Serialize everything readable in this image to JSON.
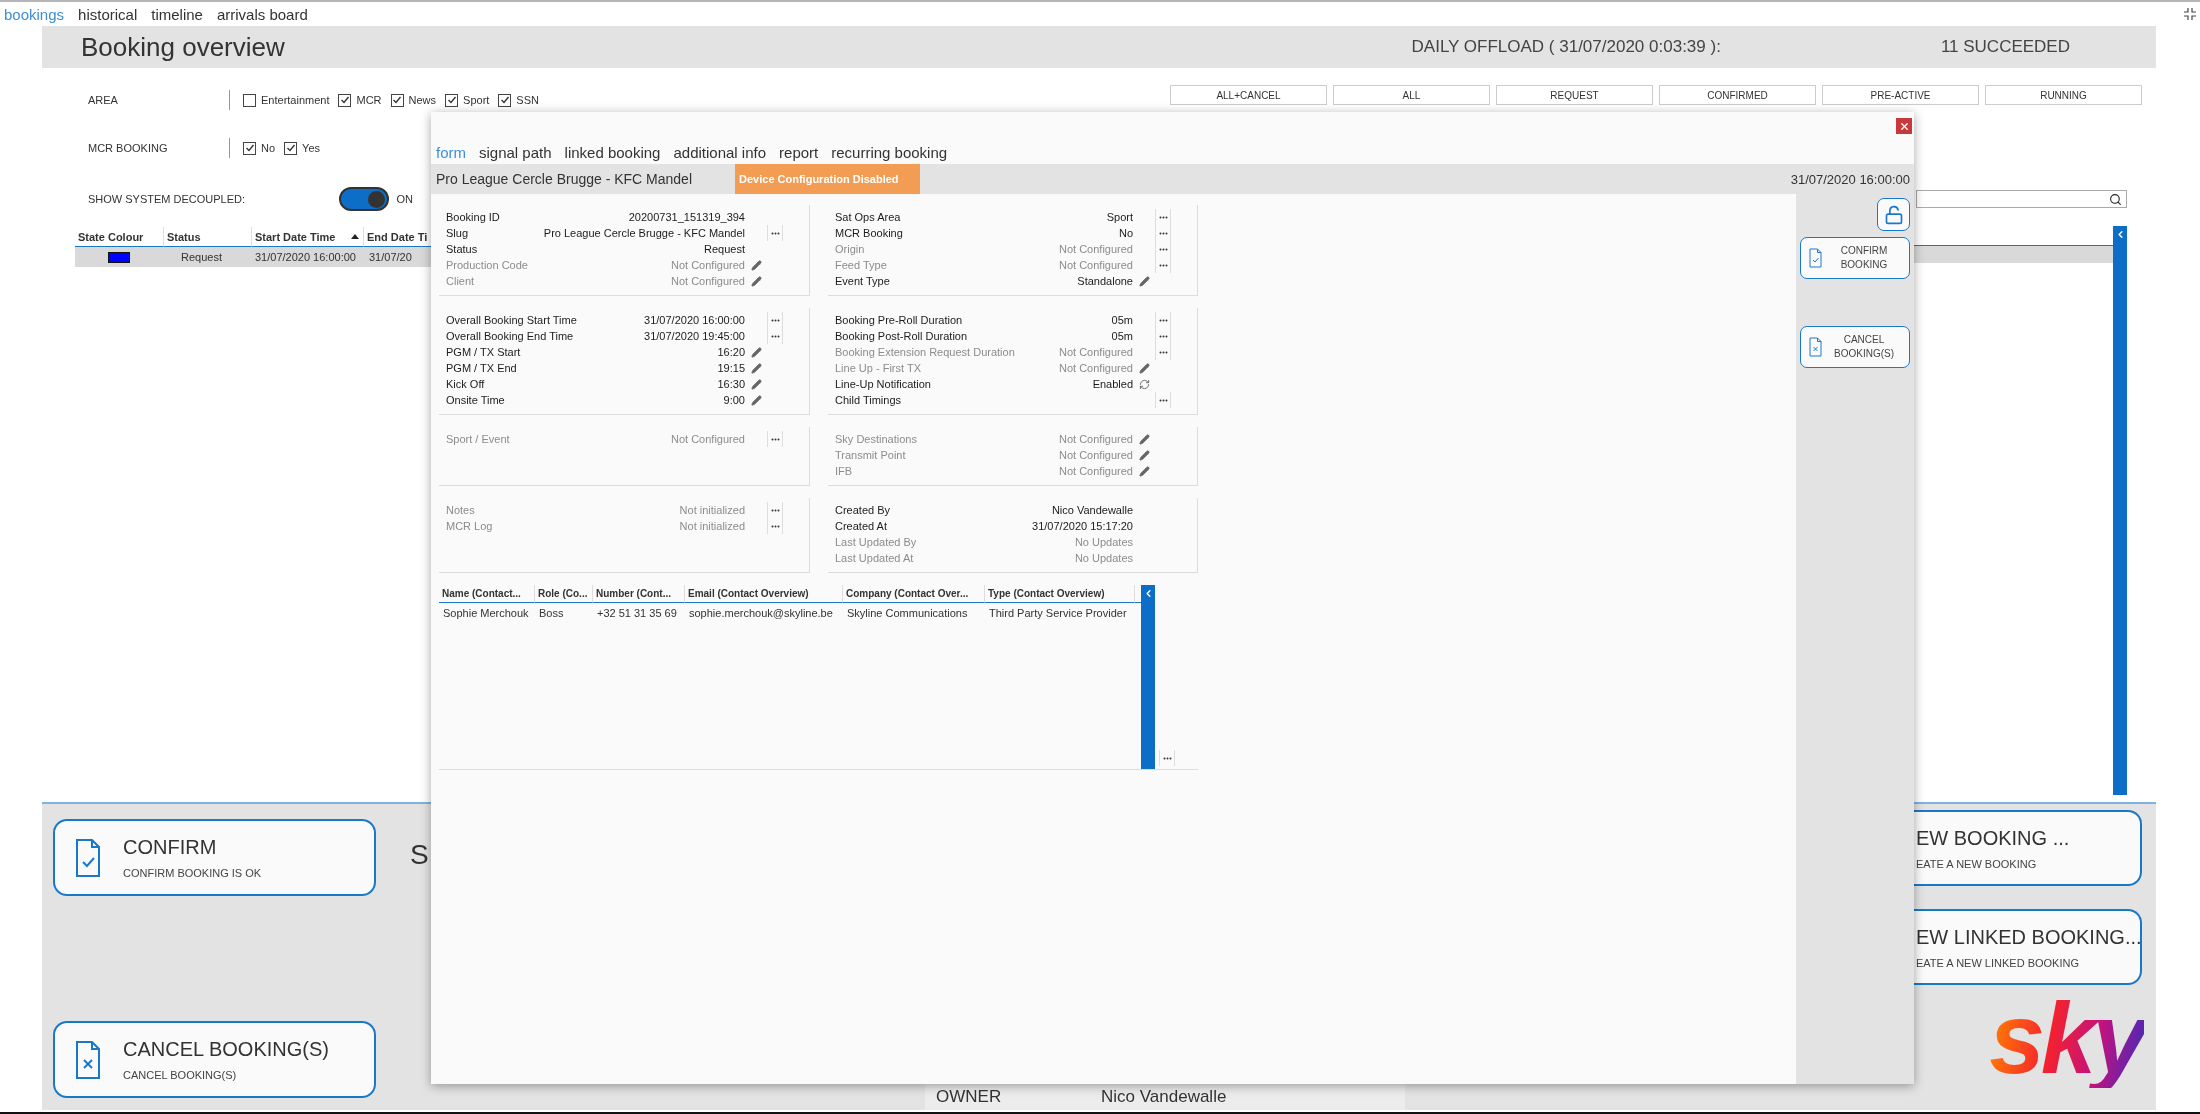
{
  "nav": [
    {
      "label": "bookings",
      "selected": true
    },
    {
      "label": "historical",
      "selected": false
    },
    {
      "label": "timeline",
      "selected": false
    },
    {
      "label": "arrivals board",
      "selected": false
    }
  ],
  "header": {
    "title": "Booking overview",
    "offload": "DAILY OFFLOAD ( 31/07/2020 0:03:39 ):",
    "result": "11 SUCCEEDED"
  },
  "status_filters": [
    "ALL+CANCEL",
    "ALL",
    "REQUEST",
    "CONFIRMED",
    "PRE-ACTIVE",
    "RUNNING"
  ],
  "filters": {
    "area": {
      "label": "AREA",
      "options": [
        {
          "label": "Entertainment",
          "checked": false
        },
        {
          "label": "MCR",
          "checked": true
        },
        {
          "label": "News",
          "checked": true
        },
        {
          "label": "Sport",
          "checked": true
        },
        {
          "label": "SSN",
          "checked": true
        }
      ]
    },
    "mcr": {
      "label": "MCR BOOKING",
      "options": [
        {
          "label": "No",
          "checked": true
        },
        {
          "label": "Yes",
          "checked": true
        }
      ]
    },
    "decoupled": {
      "label": "SHOW SYSTEM DECOUPLED:",
      "on": true,
      "state_text": "ON"
    }
  },
  "table": {
    "columns": [
      {
        "label": "State Colour"
      },
      {
        "label": "Status"
      },
      {
        "label": "Start Date Time",
        "sorted": true
      },
      {
        "label": "End Date Ti"
      }
    ],
    "rows": [
      {
        "color": "#0000ff",
        "status": "Request",
        "start": "31/07/2020 16:00:00",
        "end": "31/07/20",
        "selected": true
      }
    ]
  },
  "actions_left": [
    {
      "kind": "confirm",
      "title": "CONFIRM",
      "subtitle": "CONFIRM BOOKING IS OK"
    },
    {
      "kind": "cancel",
      "title": "CANCEL BOOKING(S)",
      "subtitle": "CANCEL BOOKING(S)"
    }
  ],
  "summary_heading": "S",
  "owner": {
    "label": "OWNER",
    "value": "Nico Vandewalle"
  },
  "actions_right": [
    {
      "title": "EW BOOKING ...",
      "subtitle": "EATE A NEW BOOKING"
    },
    {
      "title": "EW LINKED BOOKING...",
      "subtitle": "EATE A NEW LINKED BOOKING"
    }
  ],
  "logo": "sky",
  "dialog": {
    "tabs": [
      {
        "label": "form",
        "selected": true
      },
      {
        "label": "signal path",
        "selected": false
      },
      {
        "label": "linked booking",
        "selected": false
      },
      {
        "label": "additional info",
        "selected": false
      },
      {
        "label": "report",
        "selected": false
      },
      {
        "label": "recurring booking",
        "selected": false
      }
    ],
    "title": "Pro League Cercle Brugge - KFC Mandel",
    "badge": "Device Configuration Disabled",
    "date": "31/07/2020 16:00:00",
    "side_buttons": [
      {
        "kind": "unlock"
      },
      {
        "kind": "confirm",
        "label": "CONFIRM BOOKING"
      },
      {
        "kind": "cancel",
        "label": "CANCEL BOOKING(S)"
      }
    ],
    "sections": [
      {
        "rows": [
          {
            "label": "Booking ID",
            "value": "20200731_151319_394",
            "dimmed": false,
            "kind": "plain"
          },
          {
            "label": "Slug",
            "value": "Pro League Cercle Brugge - KFC Mandel",
            "dimmed": false,
            "kind": "more"
          },
          {
            "label": "Status",
            "value": "Request",
            "dimmed": false,
            "kind": "plain"
          },
          {
            "label": "Production Code",
            "value": "Not Configured",
            "dimmed": true,
            "kind": "edit"
          },
          {
            "label": "Client",
            "value": "Not Configured",
            "dimmed": true,
            "kind": "edit"
          }
        ]
      },
      {
        "rows": [
          {
            "label": "Sat Ops Area",
            "value": "Sport",
            "dimmed": false,
            "kind": "more"
          },
          {
            "label": "MCR Booking",
            "value": "No",
            "dimmed": false,
            "kind": "more"
          },
          {
            "label": "Origin",
            "value": "Not Configured",
            "dimmed": true,
            "kind": "more"
          },
          {
            "label": "Feed Type",
            "value": "Not Configured",
            "dimmed": true,
            "kind": "more"
          },
          {
            "label": "Event Type",
            "value": "Standalone",
            "dimmed": false,
            "kind": "edit"
          }
        ]
      },
      {
        "rows": [
          {
            "label": "Overall Booking Start Time",
            "value": "31/07/2020 16:00:00",
            "dimmed": false,
            "kind": "more"
          },
          {
            "label": "Overall Booking End Time",
            "value": "31/07/2020 19:45:00",
            "dimmed": false,
            "kind": "more"
          },
          {
            "label": "PGM / TX Start",
            "value": "16:20",
            "dimmed": false,
            "kind": "edit"
          },
          {
            "label": "PGM / TX End",
            "value": "19:15",
            "dimmed": false,
            "kind": "edit"
          },
          {
            "label": "Kick Off",
            "value": "16:30",
            "dimmed": false,
            "kind": "edit"
          },
          {
            "label": "Onsite Time",
            "value": "9:00",
            "dimmed": false,
            "kind": "edit"
          }
        ]
      },
      {
        "rows": [
          {
            "label": "Booking Pre-Roll Duration",
            "value": "05m",
            "dimmed": false,
            "kind": "more"
          },
          {
            "label": "Booking Post-Roll Duration",
            "value": "05m",
            "dimmed": false,
            "kind": "more"
          },
          {
            "label": "Booking Extension Request Duration",
            "value": "Not Configured",
            "dimmed": true,
            "kind": "more"
          },
          {
            "label": "Line Up - First TX",
            "value": "Not Configured",
            "dimmed": true,
            "kind": "edit"
          },
          {
            "label": "Line-Up Notification",
            "value": "Enabled",
            "dimmed": false,
            "kind": "sync"
          },
          {
            "label": "Child Timings",
            "dimmed": false,
            "kind": "more"
          }
        ]
      },
      {
        "rows": [
          {
            "label": "Sport / Event",
            "value": "Not Configured",
            "dimmed": true,
            "kind": "more"
          }
        ]
      },
      {
        "rows": [
          {
            "label": "Sky Destinations",
            "value": "Not Configured",
            "dimmed": true,
            "kind": "edit"
          },
          {
            "label": "Transmit Point",
            "value": "Not Configured",
            "dimmed": true,
            "kind": "edit"
          },
          {
            "label": "IFB",
            "value": "Not Configured",
            "dimmed": true,
            "kind": "edit"
          }
        ]
      },
      {
        "rows": [
          {
            "label": "Notes",
            "value": "Not initialized",
            "dimmed": true,
            "kind": "more"
          },
          {
            "label": "MCR Log",
            "value": "Not initialized",
            "dimmed": true,
            "kind": "more"
          }
        ]
      },
      {
        "rows": [
          {
            "label": "Created By",
            "value": "Nico Vandewalle",
            "dimmed": false,
            "kind": "plain"
          },
          {
            "label": "Created At",
            "value": "31/07/2020 15:17:20",
            "dimmed": false,
            "kind": "plain"
          },
          {
            "label": "Last Updated By",
            "value": "No Updates",
            "dimmed": true,
            "kind": "plain"
          },
          {
            "label": "Last Updated At",
            "value": "No Updates",
            "dimmed": true,
            "kind": "plain"
          }
        ]
      }
    ],
    "contacts": {
      "columns": [
        "Name (Contact...",
        "Role (Co...",
        "Number (Cont...",
        "Email (Contact Overview)",
        "Company (Contact Over...",
        "Type (Contact Overview)"
      ],
      "rows": [
        [
          "Sophie Merchouk",
          "Boss",
          "+32 51 31 35 69",
          "sophie.merchouk@skyline.be",
          "Skyline Communications",
          "Third Party Service Provider"
        ]
      ]
    }
  }
}
